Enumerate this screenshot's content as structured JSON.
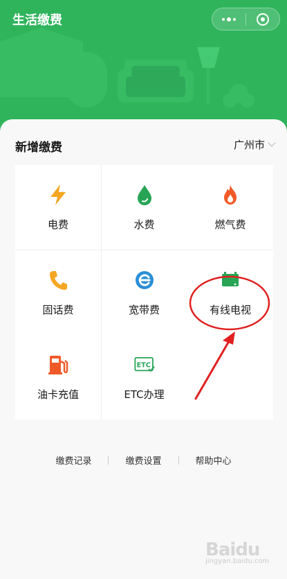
{
  "header": {
    "title": "生活缴费"
  },
  "card": {
    "title": "新增缴费",
    "city": "广州市"
  },
  "tiles": [
    {
      "label": "电费",
      "icon": "lightning-icon",
      "color": "#f5a623"
    },
    {
      "label": "水费",
      "icon": "water-drop-icon",
      "color": "#27a456"
    },
    {
      "label": "燃气费",
      "icon": "flame-icon",
      "color": "#f05a28"
    },
    {
      "label": "固话费",
      "icon": "phone-icon",
      "color": "#f5a623"
    },
    {
      "label": "宽带费",
      "icon": "broadband-e-icon",
      "color": "#2a8fd8"
    },
    {
      "label": "有线电视",
      "icon": "tv-icon",
      "color": "#27a456"
    },
    {
      "label": "油卡充值",
      "icon": "fuel-pump-icon",
      "color": "#f05a28"
    },
    {
      "label": "ETC办理",
      "icon": "etc-icon",
      "color": "#27a456"
    }
  ],
  "footer": {
    "records": "缴费记录",
    "settings": "缴费设置",
    "help": "帮助中心"
  },
  "watermark": {
    "text": "Baidu",
    "sub": "jingyan.baidu.com"
  },
  "colors": {
    "brand": "#2fb45c",
    "annotation": "#e02020"
  }
}
